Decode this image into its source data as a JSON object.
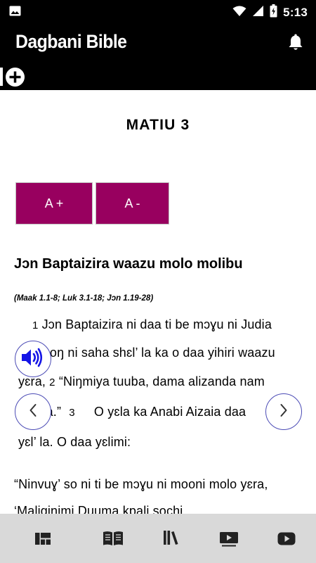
{
  "status_bar": {
    "time": "5:13",
    "icons": [
      "gallery-icon",
      "wifi-icon",
      "signal-icon",
      "battery-icon"
    ]
  },
  "app_bar": {
    "title": "Dagbani Bible",
    "action_icon": "bell-icon"
  },
  "tab_strip": {
    "add_icon": "add-circle-icon"
  },
  "chapter": {
    "title": "MATIU 3",
    "font_increase_label": "A +",
    "font_decrease_label": "A -",
    "section_heading": "Jɔn Baptaizira waazu molo molibu",
    "cross_references": "(Maak 1.1-8; Luk 3.1-18; Jɔn 1.19-28)",
    "lines": [
      {
        "verse": "1",
        "text": "Jɔn Baptaizira ni daa ti be mɔɣu ni Judia"
      },
      {
        "text": "tiŋa poŋ ni saha shɛl’ la ka o daa yihiri waazu"
      },
      {
        "text": "yɛra,",
        "verse": "2",
        "text2": "“Niŋmiya tuuba, dama alizanda nam"
      },
      {
        "text": "kpaŋa.”",
        "verse": "3",
        "text2": "O yɛla ka Anabi Aizaia daa"
      },
      {
        "text": "yɛl’ la. O daa yɛlimi:"
      },
      {
        "text": "“Ninvuɣ’ so ni ti be mɔɣu ni mooni molo yɛra,"
      },
      {
        "text": "‘Maliginimi Duuma kpali sochi,"
      }
    ]
  },
  "controls": {
    "audio_icon": "speaker-icon",
    "previous_icon": "chevron-left-icon",
    "next_icon": "chevron-right-icon"
  },
  "bottom_nav": {
    "items": [
      "dashboard-icon",
      "bible-book-icon",
      "library-icon",
      "video-icon",
      "youtube-icon"
    ]
  },
  "colors": {
    "accent": "#98005f",
    "bar_background": "#000000",
    "bottom_nav_background": "#d9d9d9",
    "control_outline": "#4b4bb5",
    "speaker": "#1515e6"
  }
}
